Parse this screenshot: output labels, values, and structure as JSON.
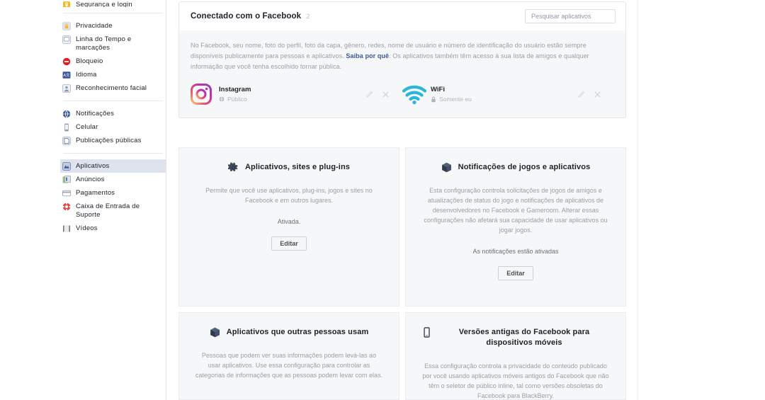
{
  "sidebar": {
    "cut_item": {
      "label": "Segurança e login",
      "icon": "shield-lock-icon"
    },
    "groups": [
      {
        "items": [
          {
            "label": "Privacidade",
            "icon": "padlock-icon"
          },
          {
            "label": "Linha do Tempo e marcações",
            "icon": "timeline-icon"
          },
          {
            "label": "Bloqueio",
            "icon": "block-icon"
          },
          {
            "label": "Idioma",
            "icon": "language-icon"
          },
          {
            "label": "Reconhecimento facial",
            "icon": "face-recognition-icon"
          }
        ]
      },
      {
        "items": [
          {
            "label": "Notificações",
            "icon": "globe-notification-icon"
          },
          {
            "label": "Celular",
            "icon": "mobile-icon"
          },
          {
            "label": "Publicações públicas",
            "icon": "public-posts-icon"
          }
        ]
      },
      {
        "items": [
          {
            "label": "Aplicativos",
            "icon": "apps-icon",
            "selected": true
          },
          {
            "label": "Anúncios",
            "icon": "ads-icon"
          },
          {
            "label": "Pagamentos",
            "icon": "payments-icon"
          },
          {
            "label": "Caixa de Entrada de Suporte",
            "icon": "support-inbox-icon"
          },
          {
            "label": "Vídeos",
            "icon": "videos-icon"
          }
        ]
      }
    ]
  },
  "panel": {
    "title": "Conectado com o Facebook",
    "count": "2",
    "search_placeholder": "Pesquisar aplicativos",
    "description_part1": "No Facebook, seu nome, foto do perfil, foto da capa, gênero, redes, nome de usuário e número de identificação do usuário estão sempre disponíveis publicamente para pessoas e aplicativos. ",
    "description_link": "Saiba por quê",
    "description_part2": ". Os aplicativos também têm acesso à sua lista de amigos e qualquer informação que você tenha escolhido tornar pública.",
    "apps": [
      {
        "name": "Instagram",
        "audience": "Público",
        "audience_icon": "globe-icon",
        "icon": "instagram-icon",
        "edit_icon": "pencil-icon",
        "remove_icon": "close-icon"
      },
      {
        "name": "WiFi",
        "audience": "Somente eu",
        "audience_icon": "lock-icon",
        "icon": "wifi-icon",
        "edit_icon": "pencil-icon",
        "remove_icon": "close-icon"
      }
    ]
  },
  "cards": [
    {
      "title": "Aplicativos, sites e plug-ins",
      "icon": "gear-icon",
      "description": "Permite que você use aplicativos, plug-ins, jogos e sites no Facebook e em outros lugares.",
      "status": "Ativada.",
      "button": "Editar"
    },
    {
      "title": "Notificações de jogos e aplicativos",
      "icon": "box-icon",
      "description": "Esta configuração controla solicitações de jogos de amigos e atualizações de status do jogo e notificações de aplicativos de desenvolvedores no Facebook e Gameroom. Alterar essas configurações não afetará sua capacidade de usar aplicativos ou jogar jogos.",
      "status": "As notificações estão ativadas",
      "button": "Editar"
    },
    {
      "title": "Aplicativos que outras pessoas usam",
      "icon": "box-icon",
      "description": "Pessoas que podem ver suas informações podem levá-las ao usar aplicativos. Use essa configuração para controlar as categorias de informações que as pessoas podem levar com elas."
    },
    {
      "title": "Versões antigas do Facebook para dispositivos móveis",
      "icon": "mobile-device-icon",
      "description": "Essa configuração controla a privacidade do conteúdo publicado por você usando aplicativos móveis antigos do Facebook que não têm o seletor de público inline, tal como versões obsoletas do Facebook para BlackBerry."
    }
  ],
  "colors": {
    "brand": "#3b5998",
    "panel_bg": "#f6f7f8",
    "selected_nav": "#dfe3ee",
    "wifi": "#29b6d8"
  }
}
